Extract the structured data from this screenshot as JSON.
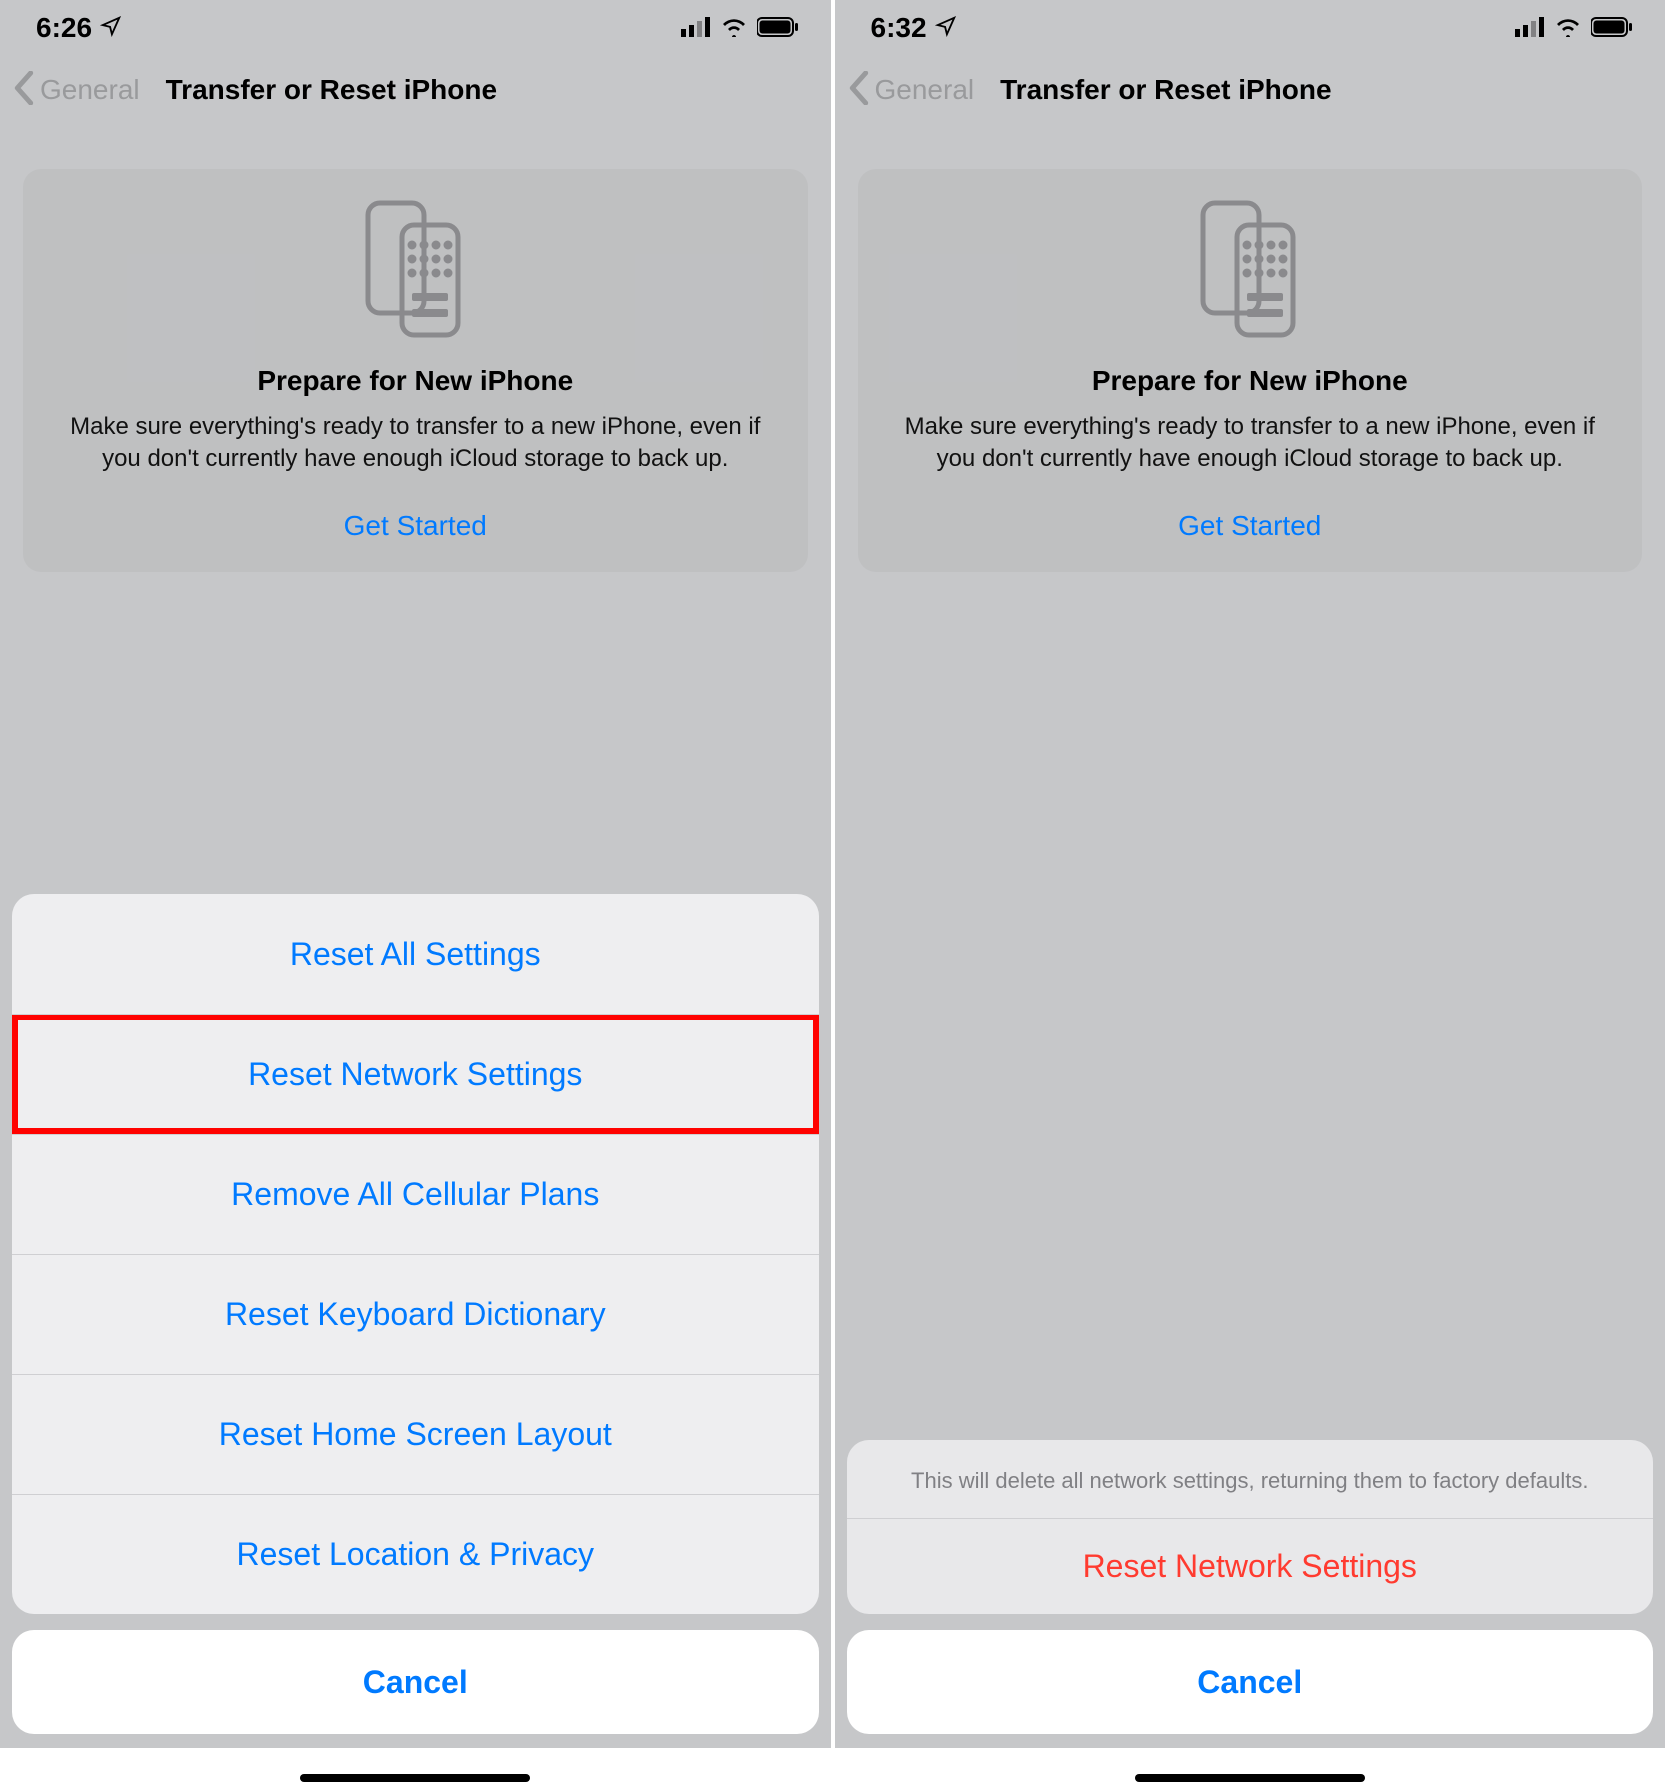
{
  "left": {
    "status": {
      "time": "6:26"
    },
    "nav": {
      "back": "General",
      "title": "Transfer or Reset iPhone"
    },
    "card": {
      "title": "Prepare for New iPhone",
      "desc": "Make sure everything's ready to transfer to a new iPhone, even if you don't currently have enough iCloud storage to back up.",
      "cta": "Get Started"
    },
    "sheet": {
      "items": [
        "Reset All Settings",
        "Reset Network Settings",
        "Remove All Cellular Plans",
        "Reset Keyboard Dictionary",
        "Reset Home Screen Layout",
        "Reset Location & Privacy"
      ],
      "cancel": "Cancel",
      "highlighted_index": 1
    }
  },
  "right": {
    "status": {
      "time": "6:32"
    },
    "nav": {
      "back": "General",
      "title": "Transfer or Reset iPhone"
    },
    "card": {
      "title": "Prepare for New iPhone",
      "desc": "Make sure everything's ready to transfer to a new iPhone, even if you don't currently have enough iCloud storage to back up.",
      "cta": "Get Started"
    },
    "sheet": {
      "header": "This will delete all network settings, returning them to factory defaults.",
      "confirm": "Reset Network Settings",
      "cancel": "Cancel"
    }
  }
}
